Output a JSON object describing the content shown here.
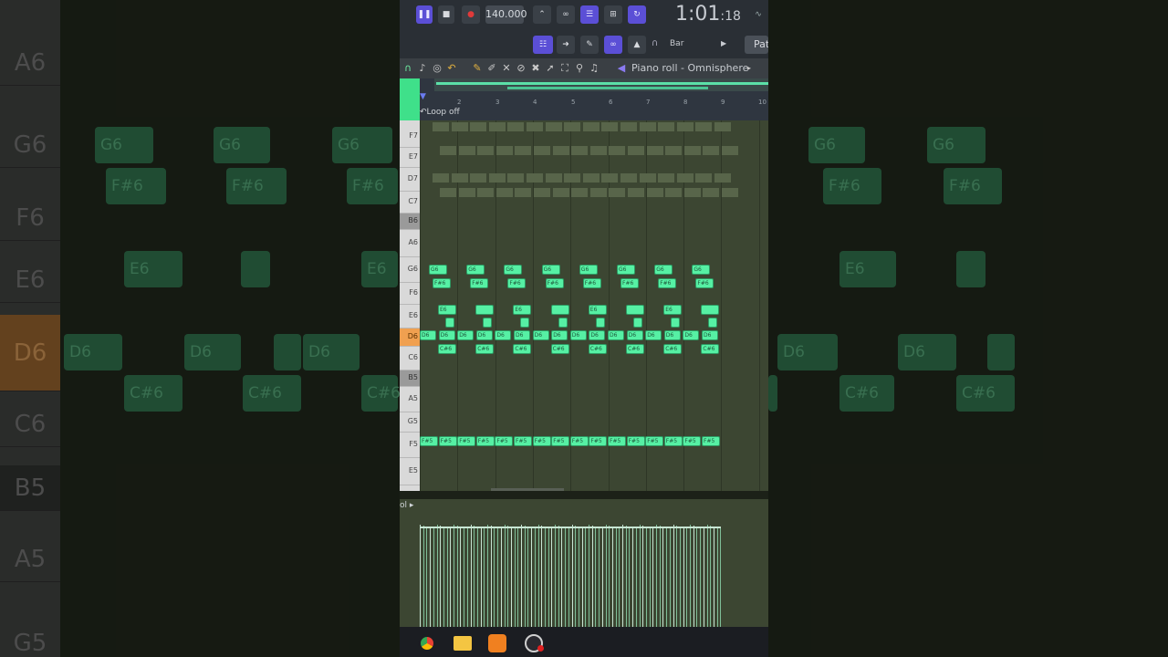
{
  "transport": {
    "tempo": "140.000",
    "time_main": "1:01",
    "time_sub": "18",
    "snap": "Bar",
    "pattern_button": "Pat"
  },
  "piano_roll": {
    "title": "Piano roll - Omnisphere",
    "loop_label": "Loop off",
    "ruler_numbers": [
      "2",
      "3",
      "4",
      "5",
      "6",
      "7",
      "8",
      "9",
      "10"
    ],
    "keys": [
      "F7",
      "E7",
      "D7",
      "C7",
      "B6",
      "A6",
      "G6",
      "F6",
      "E6",
      "D6",
      "C6",
      "B5",
      "A5",
      "G5",
      "F5",
      "E5"
    ],
    "active_key": "D6",
    "note_labels": {
      "g6": "G6",
      "fs6": "F#6",
      "e6": "E6",
      "d6": "D6",
      "cs6": "C#6",
      "fs5": "F#5"
    }
  },
  "velocity_panel": {
    "label": "ol"
  },
  "background": {
    "keys": [
      "A6",
      "G6",
      "F6",
      "E6",
      "D6",
      "C6",
      "B5",
      "A5",
      "G5"
    ],
    "note_labels": [
      "G6",
      "F#6",
      "E6",
      "D6",
      "C#6"
    ]
  },
  "taskbar": {
    "icons": [
      "chrome-icon",
      "file-explorer-icon",
      "fl-studio-icon",
      "recorder-icon"
    ]
  },
  "colors": {
    "note_green": "#56f0a4",
    "accent_purple": "#5b4fd6",
    "active_key_orange": "#f0a050"
  }
}
